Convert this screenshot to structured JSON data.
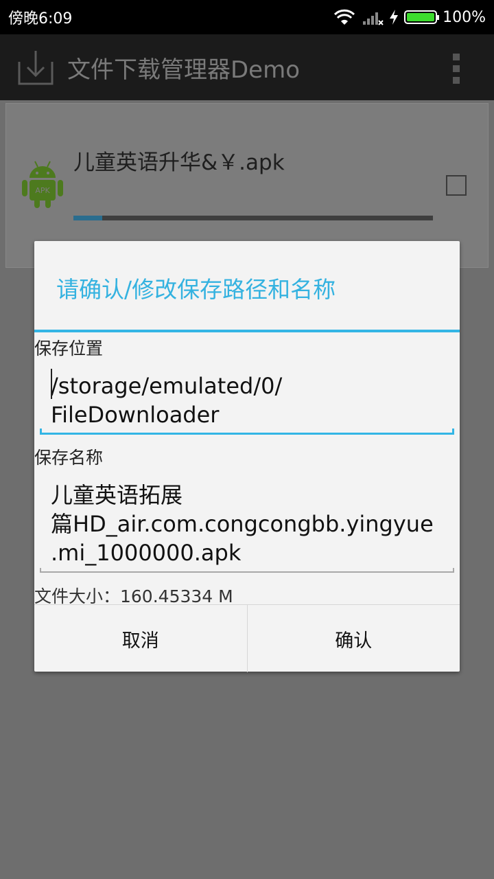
{
  "status_bar": {
    "time": "傍晚6:09",
    "battery_text": "100%",
    "battery_level": 1.0,
    "icons": [
      "wifi-icon",
      "signal-icon",
      "charging-icon",
      "battery-icon"
    ]
  },
  "action_bar": {
    "title": "文件下载管理器Demo",
    "icons": [
      "download-icon",
      "overflow-menu-icon"
    ]
  },
  "list_item": {
    "title": "儿童英语升华&￥.apk",
    "progress": 0.08,
    "checked": false,
    "icon": "android-apk-icon"
  },
  "dialog": {
    "title": "请确认/修改保存路径和名称",
    "save_location_label": "保存位置",
    "save_location_line1": "/storage/emulated/0/",
    "save_location_line2": "FileDownloader",
    "save_name_label": "保存名称",
    "save_name_line1": "儿童英语拓展",
    "save_name_line2": "篇HD_air.com.congcongbb.yingyue",
    "save_name_line3": ".mi_1000000.apk",
    "file_size": "文件大小：160.45334 M",
    "cancel_label": "取消",
    "confirm_label": "确认"
  },
  "colors": {
    "accent": "#33b5e5",
    "battery_green": "#3ddc2e"
  }
}
